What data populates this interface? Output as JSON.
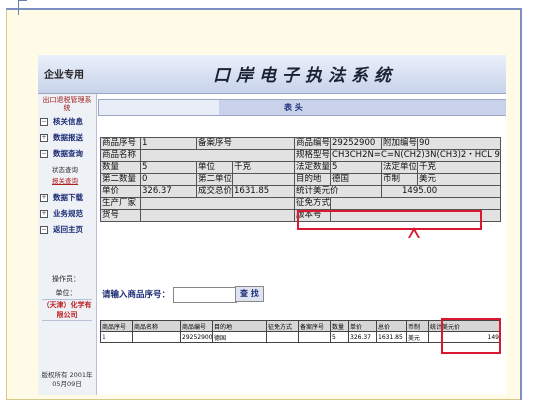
{
  "app": {
    "brand": "企业专用",
    "title": "口岸电子执法系统"
  },
  "sidebar": {
    "title": "出口退税管理系统",
    "items": [
      {
        "label": "核关信息",
        "box": "−"
      },
      {
        "label": "数据报送",
        "box": "+"
      },
      {
        "label": "数据查询",
        "box": "−"
      },
      {
        "label": "数据下载",
        "box": "+"
      },
      {
        "label": "业务规范",
        "box": "+"
      },
      {
        "label": "返回主页",
        "box": "−"
      }
    ],
    "subitems": [
      {
        "label": "状态查询"
      },
      {
        "label": "报关查询"
      }
    ],
    "operator_label": "操作员：",
    "unit_label": "单位：",
    "company": "（天津）化学有限公司",
    "copyright": "版权所有 2001年05月09日"
  },
  "header_bar": {
    "text": "表 头"
  },
  "detail": {
    "product_seq_label": "商品序号",
    "product_seq_value": "1",
    "record_seq_label": "备案序号",
    "record_seq_value": "",
    "product_code_label": "商品编号",
    "product_code_value": "29252900",
    "extra_code_label": "附加编号",
    "extra_code_value": "90",
    "product_name_label": "商品名称",
    "product_name_value": "",
    "spec_label": "规格型号",
    "spec_value": "CH3CH2N=C=N(CH2)3N(CH3)2・HCL 9",
    "qty_label": "数量",
    "qty_value": "5",
    "unit_label": "单位",
    "unit_value": "千克",
    "legal_qty_label": "法定数量",
    "legal_qty_value": "5",
    "legal_unit_label": "法定单位",
    "legal_unit_value": "千克",
    "qty2_label": "第二数量",
    "qty2_value": "0",
    "unit2_label": "第二单位",
    "unit2_value": "",
    "dest_label": "目的地",
    "dest_value": "德国",
    "currency_label": "币制",
    "currency_value": "美元",
    "unit_price_label": "单价",
    "unit_price_value": "326.37",
    "total_label": "成交总价",
    "total_value": "1631.85",
    "usd_label": "统计美元价",
    "usd_value": "1495.00",
    "producer_label": "生产厂家",
    "producer_value": "",
    "exemption_label": "征免方式",
    "exemption_value": "",
    "goods_no_label": "货号",
    "goods_no_value": "",
    "version_label": "版本号",
    "version_value": ""
  },
  "search": {
    "prompt": "请输入商品序号：",
    "value": "",
    "button": "查 找"
  },
  "list": {
    "headers": [
      "商品序号",
      "商品名称",
      "商品编号",
      "目的地",
      "征免方式",
      "备案序号",
      "数量",
      "单价",
      "总价",
      "币制",
      "统计美元价"
    ],
    "rows": [
      [
        "1",
        "",
        "29252900",
        "德国",
        "",
        "",
        "5",
        "326.37",
        "1631.85",
        "美元",
        "149"
      ]
    ]
  },
  "colors": {
    "highlight": "#d8192f",
    "nav_text": "#1b2c74",
    "header_bar": "#c9d2ea"
  }
}
